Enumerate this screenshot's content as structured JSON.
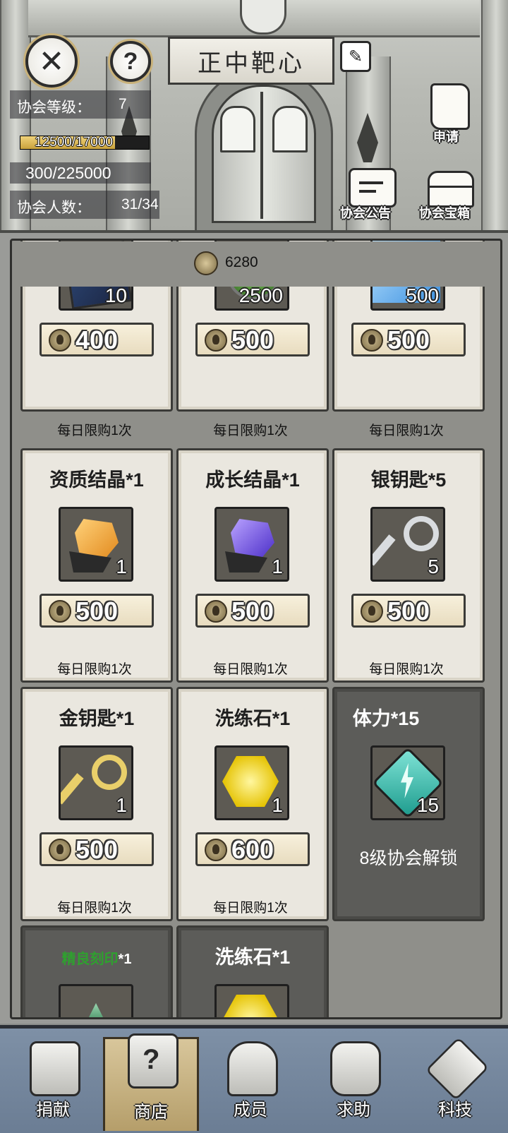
{
  "header": {
    "title": "正中靶心",
    "guild_level_label": "协会等级：",
    "guild_level_value": "7",
    "exp_text": "12500/17000",
    "exp_progress": 0.735,
    "funds_text": "300/225000",
    "member_label": "协会人数：",
    "member_value": "31/34",
    "apply_label": "申请",
    "notice_label": "协会公告",
    "chest_label": "协会宝箱"
  },
  "shop": {
    "coin_balance": "6280",
    "limit_text": "每日限购1次",
    "row_top": [
      {
        "qty": "10",
        "price": "400",
        "icon": "book-icon"
      },
      {
        "qty": "2500",
        "price": "500",
        "icon": "green-emblem-icon"
      },
      {
        "qty": "500",
        "price": "500",
        "icon": "blue-crystal-icon"
      }
    ],
    "row2": [
      {
        "name": "资质结晶*1",
        "qty": "1",
        "price": "500",
        "icon": "orange-crystal-icon"
      },
      {
        "name": "成长结晶*1",
        "qty": "1",
        "price": "500",
        "icon": "purple-crystal-icon"
      },
      {
        "name": "银钥匙*5",
        "qty": "5",
        "price": "500",
        "icon": "silver-key-icon"
      }
    ],
    "row3": [
      {
        "name": "金钥匙*1",
        "qty": "1",
        "price": "500",
        "icon": "gold-key-icon"
      },
      {
        "name": "洗练石*1",
        "qty": "1",
        "price": "600",
        "icon": "yellow-gem-icon"
      },
      {
        "name": "体力*15",
        "qty": "15",
        "unlock": "8级协会解锁",
        "icon": "energy-icon"
      }
    ],
    "row4": [
      {
        "name_green": "精良刻印",
        "name_suffix": "*1",
        "icon": "green-rune-icon"
      },
      {
        "name": "洗练石*1",
        "icon": "yellow-gem-icon"
      }
    ]
  },
  "nav": [
    {
      "label": "捐献",
      "icon": "donate-icon"
    },
    {
      "label": "商店",
      "icon": "shop-icon"
    },
    {
      "label": "成员",
      "icon": "members-icon"
    },
    {
      "label": "求助",
      "icon": "help-fist-icon"
    },
    {
      "label": "科技",
      "icon": "tech-icon"
    }
  ],
  "colors": {
    "accent": "#c9b27a",
    "nav_bg": "#7488a0",
    "locked_card": "#5c5c59",
    "green_text": "#2fa02f"
  }
}
